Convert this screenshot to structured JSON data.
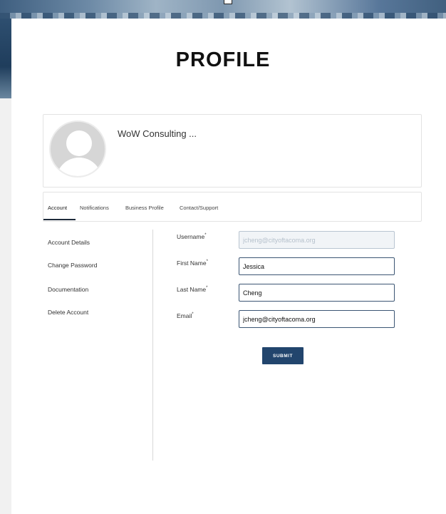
{
  "page": {
    "title": "PROFILE"
  },
  "profile": {
    "company_name": "WoW Consulting ..."
  },
  "tabs": [
    {
      "label": "Account",
      "active": true
    },
    {
      "label": "Notifications",
      "active": false
    },
    {
      "label": "Business Profile",
      "active": false
    },
    {
      "label": "Contact/Support",
      "active": false
    }
  ],
  "sidebar": {
    "items": [
      {
        "label": "Account Details"
      },
      {
        "label": "Change Password"
      },
      {
        "label": "Documentation"
      },
      {
        "label": "Delete Account"
      }
    ]
  },
  "form": {
    "username": {
      "label": "Username",
      "required_mark": "*",
      "value": "jcheng@cityoftacoma.org",
      "disabled": true
    },
    "first_name": {
      "label": "First Name",
      "required_mark": "*",
      "value": "Jessica"
    },
    "last_name": {
      "label": "Last Name",
      "required_mark": "*",
      "value": "Cheng"
    },
    "email": {
      "label": "Email",
      "required_mark": "*",
      "value": "jcheng@cityoftacoma.org"
    },
    "submit_label": "SUBMIT"
  },
  "colors": {
    "accent": "#22456d",
    "input_border": "#3b5573",
    "disabled_input_bg": "#f1f4f7"
  },
  "icons": {
    "avatar": "user-silhouette-icon"
  }
}
